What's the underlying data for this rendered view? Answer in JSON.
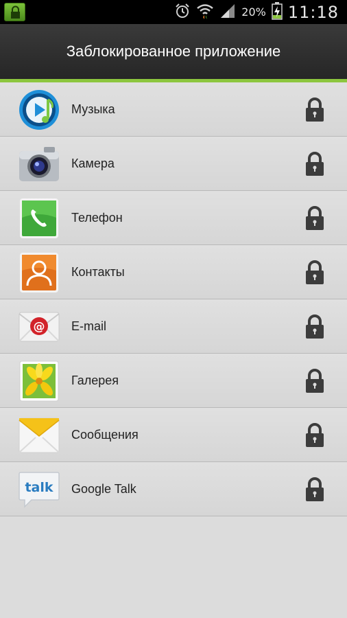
{
  "status_bar": {
    "battery_percent": "20%",
    "time": "11:18",
    "icons": [
      "lock-notification-icon",
      "alarm-icon",
      "wifi-icon",
      "signal-icon",
      "battery-charging-icon"
    ]
  },
  "header": {
    "title": "Заблокированное приложение"
  },
  "theme": {
    "accent": "#8dc63f",
    "header_bg": "#2e2e2e",
    "list_bg": "#dcdcdc"
  },
  "apps": [
    {
      "label": "Музыка",
      "icon": "music-player-icon",
      "locked": true
    },
    {
      "label": "Камера",
      "icon": "camera-icon",
      "locked": true
    },
    {
      "label": "Телефон",
      "icon": "phone-icon",
      "locked": true
    },
    {
      "label": "Контакты",
      "icon": "contacts-icon",
      "locked": true
    },
    {
      "label": "E-mail",
      "icon": "email-icon",
      "locked": true
    },
    {
      "label": "Галерея",
      "icon": "gallery-icon",
      "locked": true
    },
    {
      "label": "Сообщения",
      "icon": "messages-icon",
      "locked": true
    },
    {
      "label": "Google Talk",
      "icon": "google-talk-icon",
      "locked": true
    }
  ]
}
